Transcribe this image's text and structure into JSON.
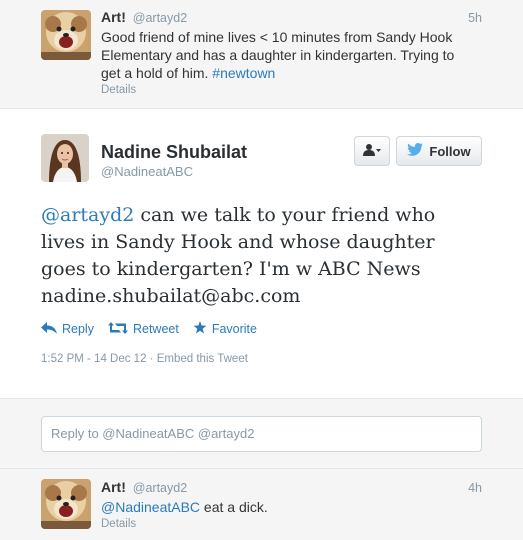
{
  "top_tweet": {
    "fullname": "Art!",
    "handle": "@artayd2",
    "time": "5h",
    "text_line1": "Good friend of mine lives < 10 minutes from Sandy Hook",
    "text_line2": "Elementary and has a daughter in kindergarten. Trying to",
    "text_line3_prefix": "get a hold of him.",
    "hashtag": "#newtown",
    "details": "Details"
  },
  "main_tweet": {
    "fullname": "Nadine Shubailat",
    "handle": "@NadineatABC",
    "follow_label": "Follow",
    "mention": "@artayd2",
    "line1_rest": " can we talk to your friend who",
    "line2": "lives in Sandy Hook and whose daughter",
    "line3": "goes to kindergarten? I'm w ABC News",
    "line4": "nadine.shubailat@abc.com",
    "reply_label": "Reply",
    "retweet_label": "Retweet",
    "favorite_label": "Favorite",
    "time": "1:52 PM - 14 Dec 12",
    "separator": " · ",
    "embed_label": "Embed this Tweet"
  },
  "reply_box": {
    "placeholder": "Reply to @NadineatABC @artayd2"
  },
  "bottom_tweet": {
    "fullname": "Art!",
    "handle": "@artayd2",
    "time": "4h",
    "mention": "@NadineatABC",
    "text_rest": " eat a dick.",
    "details": "Details"
  },
  "colors": {
    "link": "#2b7bb9",
    "muted": "#8899a6",
    "follow_bird": "#55acee"
  },
  "icons": [
    "dog-avatar",
    "woman-avatar",
    "person-icon",
    "twitter-bird-icon",
    "reply-icon",
    "retweet-icon",
    "star-icon"
  ]
}
